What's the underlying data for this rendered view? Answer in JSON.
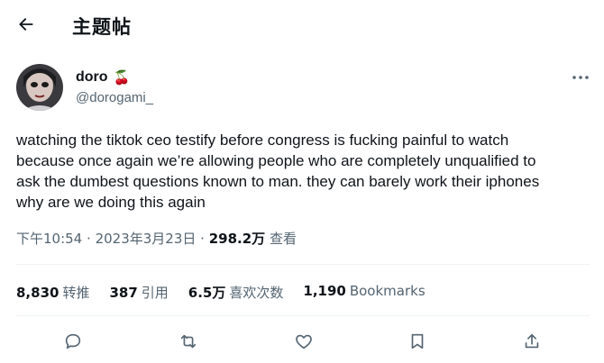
{
  "header": {
    "title": "主题帖"
  },
  "author": {
    "name": "doro",
    "emoji": "🍒",
    "handle": "@dorogami_"
  },
  "tweet": {
    "text": "watching the tiktok ceo testify before congress is fucking painful to watch because once again we’re allowing people who are completely unqualified to ask the dumbest questions known to man. they can barely work their iphones why are we doing this again"
  },
  "meta": {
    "time": "下午10:54",
    "date": "2023年3月23日",
    "views_count": "298.2万",
    "views_label": "查看"
  },
  "stats": {
    "retweets": {
      "count": "8,830",
      "label": "转推"
    },
    "quotes": {
      "count": "387",
      "label": "引用"
    },
    "likes": {
      "count": "6.5万",
      "label": "喜欢次数"
    },
    "bookmarks": {
      "count": "1,190",
      "label": "Bookmarks"
    }
  },
  "colors": {
    "text": "#0f1419",
    "secondary": "#536471",
    "divider": "#eff3f4"
  }
}
